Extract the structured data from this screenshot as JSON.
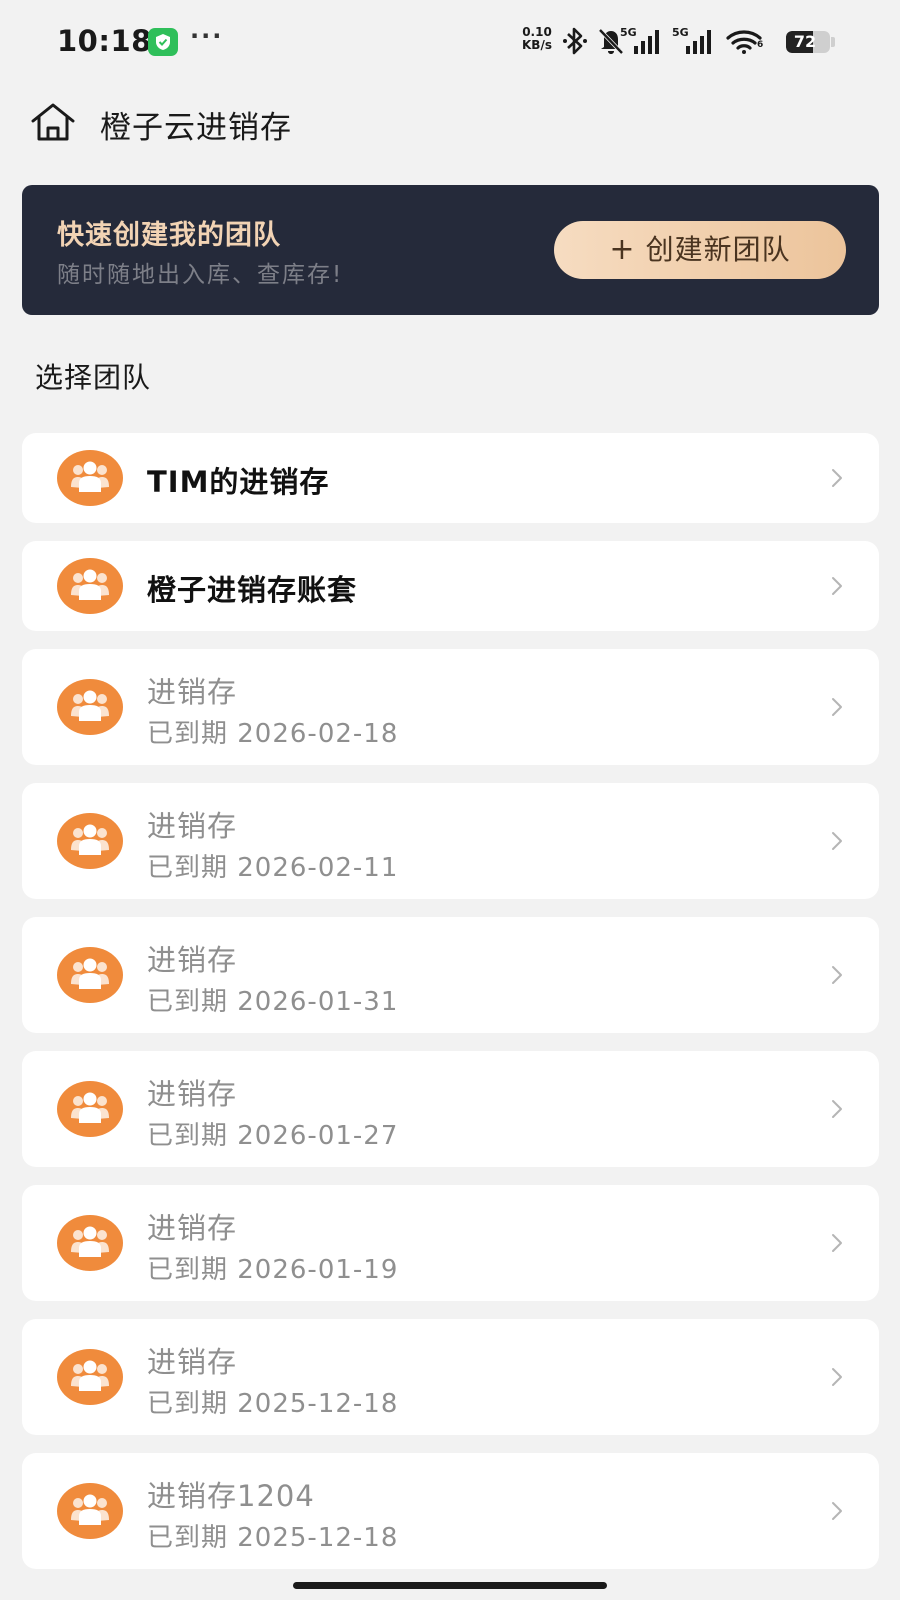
{
  "status_bar": {
    "time": "10:18",
    "more": "···",
    "speed_value": "0.10",
    "speed_unit": "KB/s",
    "signal1_label": "5G",
    "signal2_label": "5G",
    "wifi_label": "6",
    "battery_level": 72,
    "battery_text": "72"
  },
  "header": {
    "title": "橙子云进销存"
  },
  "banner": {
    "title": "快速创建我的团队",
    "subtitle": "随时随地出入库、查库存!",
    "button_plus": "+",
    "button_label": "创建新团队"
  },
  "section": {
    "label": "选择团队"
  },
  "teams": [
    {
      "name": "TIM的进销存",
      "expiry": ""
    },
    {
      "name": "橙子进销存账套",
      "expiry": ""
    },
    {
      "name": "进销存",
      "expiry": "已到期 2026-02-18"
    },
    {
      "name": "进销存",
      "expiry": "已到期 2026-02-11"
    },
    {
      "name": "进销存",
      "expiry": "已到期 2026-01-31"
    },
    {
      "name": "进销存",
      "expiry": "已到期 2026-01-27"
    },
    {
      "name": "进销存",
      "expiry": "已到期 2026-01-19"
    },
    {
      "name": "进销存",
      "expiry": "已到期 2025-12-18"
    },
    {
      "name": "进销存1204",
      "expiry": "已到期 2025-12-18"
    }
  ],
  "colors": {
    "accent": "#f08b3c",
    "banner_bg": "#252a3a",
    "banner_title": "#f2d3b4",
    "button_bg": "#f2cfab"
  }
}
